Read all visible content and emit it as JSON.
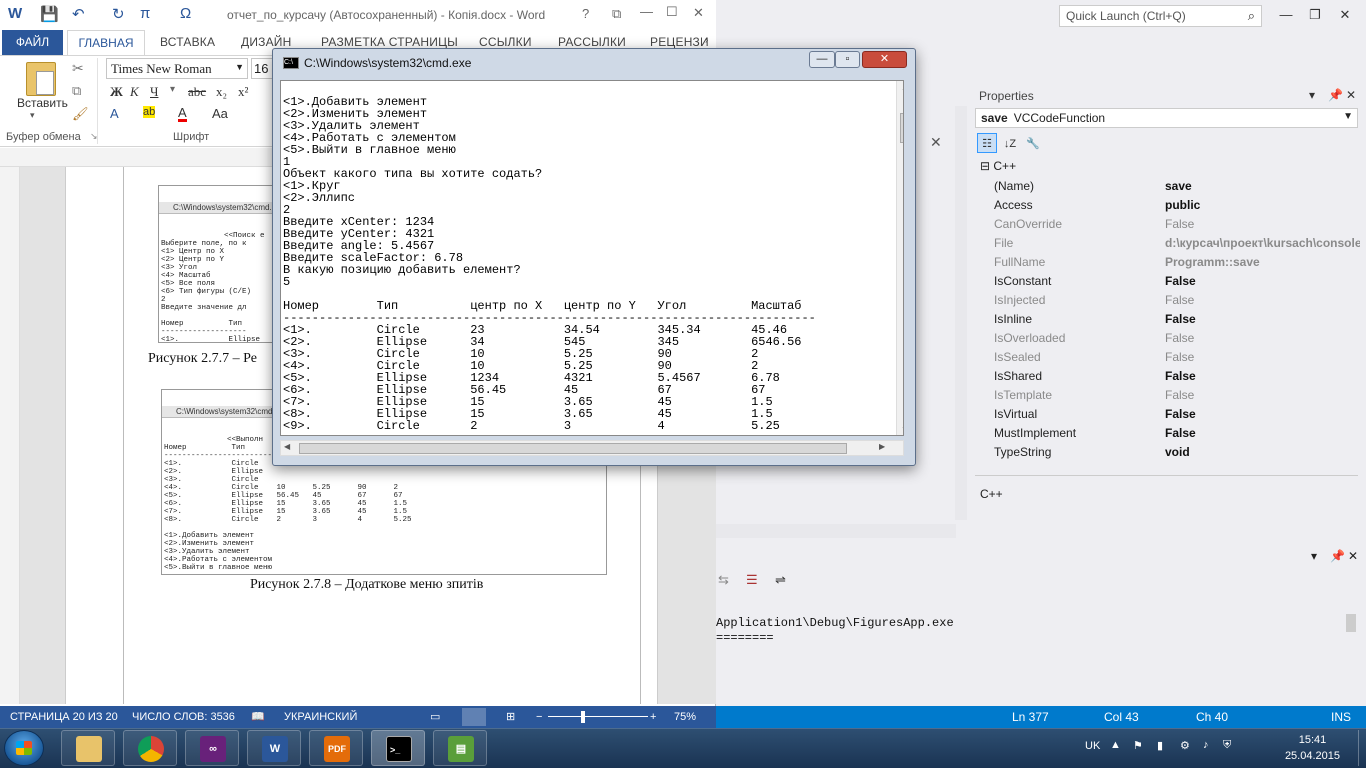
{
  "vs": {
    "quick_launch_placeholder": "Quick Launch (Ctrl+Q)",
    "properties": {
      "title": "Properties",
      "object_name": "save",
      "object_type": "VCCodeFunction",
      "category": "C++",
      "rows": [
        {
          "name": "(Name)",
          "value": "save"
        },
        {
          "name": "Access",
          "value": "public"
        },
        {
          "name": "CanOverride",
          "value": "False"
        },
        {
          "name": "File",
          "value": "d:\\курсач\\проект\\kursach\\console"
        },
        {
          "name": "FullName",
          "value": "Programm::save"
        },
        {
          "name": "IsConstant",
          "value": "False"
        },
        {
          "name": "IsInjected",
          "value": "False"
        },
        {
          "name": "IsInline",
          "value": "False"
        },
        {
          "name": "IsOverloaded",
          "value": "False"
        },
        {
          "name": "IsSealed",
          "value": "False"
        },
        {
          "name": "IsShared",
          "value": "False"
        },
        {
          "name": "IsTemplate",
          "value": "False"
        },
        {
          "name": "IsVirtual",
          "value": "False"
        },
        {
          "name": "MustImplement",
          "value": "False"
        },
        {
          "name": "TypeString",
          "value": "void"
        }
      ],
      "description": "C++"
    },
    "output_lines": [
      "Application1\\Debug\\FiguresApp.exe",
      "========"
    ],
    "status": {
      "line": "Ln 377",
      "col": "Col 43",
      "ch": "Ch 40",
      "mode": "INS"
    }
  },
  "word": {
    "doc_title": "отчет_по_курсачу (Автосохраненный) - Копія.docx - Word",
    "tabs": {
      "file": "ФАЙЛ",
      "home": "ГЛАВНАЯ",
      "insert": "ВСТАВКА",
      "design": "ДИЗАЙН",
      "layout": "РАЗМЕТКА СТРАНИЦЫ",
      "refs": "ССЫЛКИ",
      "mailings": "РАССЫЛКИ",
      "review": "РЕЦЕНЗИ"
    },
    "ribbon": {
      "paste_label": "Вставить",
      "font_name": "Times New Roman",
      "font_size": "16",
      "clipboard_group": "Буфер обмена",
      "font_group": "Шрифт"
    },
    "page": {
      "shot1_title": "C:\\Windows\\system32\\cmd.exe",
      "shot1_text": "              <<Поиск е\nВыберите поле, по к\n<1> Центр по X\n<2> Центр по Y\n<3> Угол\n<4> Масштаб\n<5> Все поля\n<6> Тип фигуры (C/E)\n2\nВведите значение дл\n\nНомер          Тип\n-------------------\n<1>.           Ellipse\n<2>.           Ellipse\nPress any key to co",
      "caption1": "Рисунок 2.7.7 – Ре",
      "shot2_title": "C:\\Windows\\system32\\cmd.exe",
      "shot2_text": "              <<Выполн\nНомер          Тип\n-----------------------------------------------------\n<1>.           Circle\n<2>.           Ellipse\n<3>.           Circle\n<4>.           Circle    10      5.25      90      2\n<5>.           Ellipse   56.45   45        67      67\n<6>.           Ellipse   15      3.65      45      1.5\n<7>.           Ellipse   15      3.65      45      1.5\n<8>.           Circle    2       3         4       5.25\n\n<1>.Добавить элемент\n<2>.Изменить элемент\n<3>.Удалить элемент\n<4>.Работать с элементом\n<5>.Выйти в главное меню",
      "caption2": "Рисунок 2.7.8 – Додаткове меню зпитів"
    },
    "status": {
      "page": "СТРАНИЦА 20 ИЗ 20",
      "words": "ЧИСЛО СЛОВ: 3536",
      "lang": "УКРАИНСКИЙ",
      "zoom": "75%"
    }
  },
  "cmd": {
    "title": "C:\\Windows\\system32\\cmd.exe",
    "text": "<1>.Добавить элемент\n<2>.Изменить элемент\n<3>.Удалить элемент\n<4>.Работать с элементом\n<5>.Выйти в главное меню\n1\nОбъект какого типа вы хотите содать?\n<1>.Круг\n<2>.Эллипс\n2\nВведите xCenter: 1234\nВведите yCenter: 4321\nВведите angle: 5.4567\nВведите scaleFactor: 6.78\nВ какую позицию добавить елемент?\n5\n\nНомер        Тип          центр по X   центр по Y   Угол         Масштаб\n--------------------------------------------------------------------------\n<1>.         Circle       23           34.54        345.34       45.46\n<2>.         Ellipse      34           545          345          6546.56\n<3>.         Circle       10           5.25         90           2\n<4>.         Circle       10           5.25         90           2\n<5>.         Ellipse      1234         4321         5.4567       6.78\n<6>.         Ellipse      56.45        45           67           67\n<7>.         Ellipse      15           3.65         45           1.5\n<8>.         Ellipse      15           3.65         45           1.5\n<9>.         Circle       2            3            4            5.25"
  },
  "taskbar": {
    "lang": "UK",
    "time": "15:41",
    "date": "25.04.2015",
    "apps": [
      "explorer-icon",
      "chrome-icon",
      "visual-studio-icon",
      "word-icon",
      "pdf-icon",
      "cmd-icon",
      "app-icon"
    ],
    "word_icon_text": "W",
    "pdf_icon_text": "PDF"
  }
}
